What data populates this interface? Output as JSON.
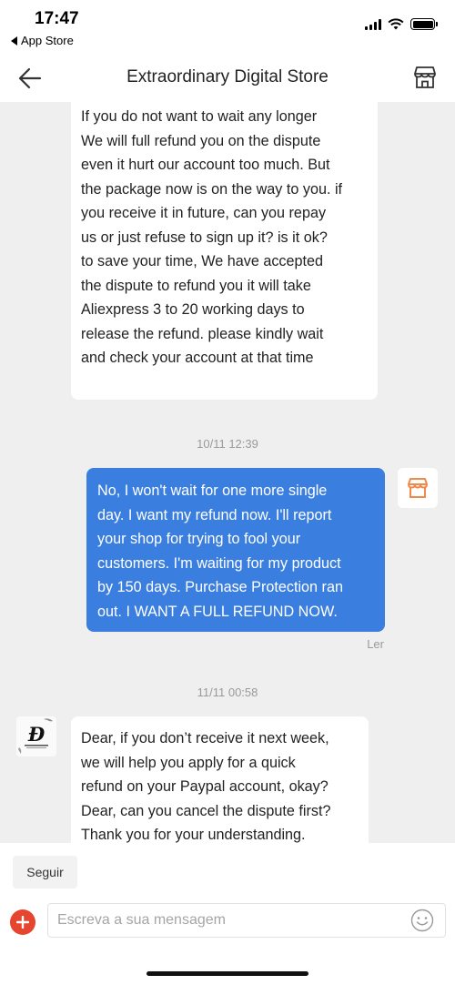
{
  "status_bar": {
    "time": "17:47",
    "back_app_label": "App Store"
  },
  "header": {
    "title": "Extraordinary Digital Store"
  },
  "messages": [
    {
      "direction": "incoming",
      "lines": [
        " If you do not want to wait any longer",
        "We will full refund you on the dispute",
        "even it hurt our account too much. But",
        "the package now is on the way to you. if",
        "you receive it in future, can you repay",
        "us or just refuse to sign up it? is it ok?",
        "to save your time, We have accepted",
        "the dispute to refund you it will take",
        "Aliexpress 3 to 20 working days to",
        "release the refund. please kindly wait",
        "and check your account at that time"
      ]
    },
    {
      "timestamp": "10/11 12:39",
      "direction": "outgoing",
      "lines": [
        "No, I won't wait for one more single",
        "day. I want my refund now. I'll report",
        "your shop for trying to fool your",
        "customers. I'm waiting for my product",
        "by 150 days. Purchase Protection ran",
        "out. I WANT A FULL REFUND NOW."
      ],
      "read_status": "Ler"
    },
    {
      "timestamp": "11/11 00:58",
      "direction": "incoming",
      "lines": [
        "Dear, if you don’t receive it next week,",
        "we will help you apply for a quick",
        "refund on your Paypal account, okay?",
        "Dear, can you cancel the dispute first?",
        "Thank you for your understanding."
      ]
    }
  ],
  "bottom_bar": {
    "follow_label": "Seguir",
    "message_placeholder": "Escreva a sua mensagem"
  },
  "colors": {
    "outgoing_bubble": "#3a7ee0",
    "chat_background": "#efefef",
    "add_button": "#e64530",
    "store_icon_accent": "#f08a4b"
  },
  "icons": {
    "back_app": "triangle-left-icon",
    "nav_back": "arrow-left-icon",
    "nav_store": "storefront-icon",
    "store_avatar": "storefront-icon",
    "add": "plus-icon",
    "emoji": "smiley-icon"
  }
}
